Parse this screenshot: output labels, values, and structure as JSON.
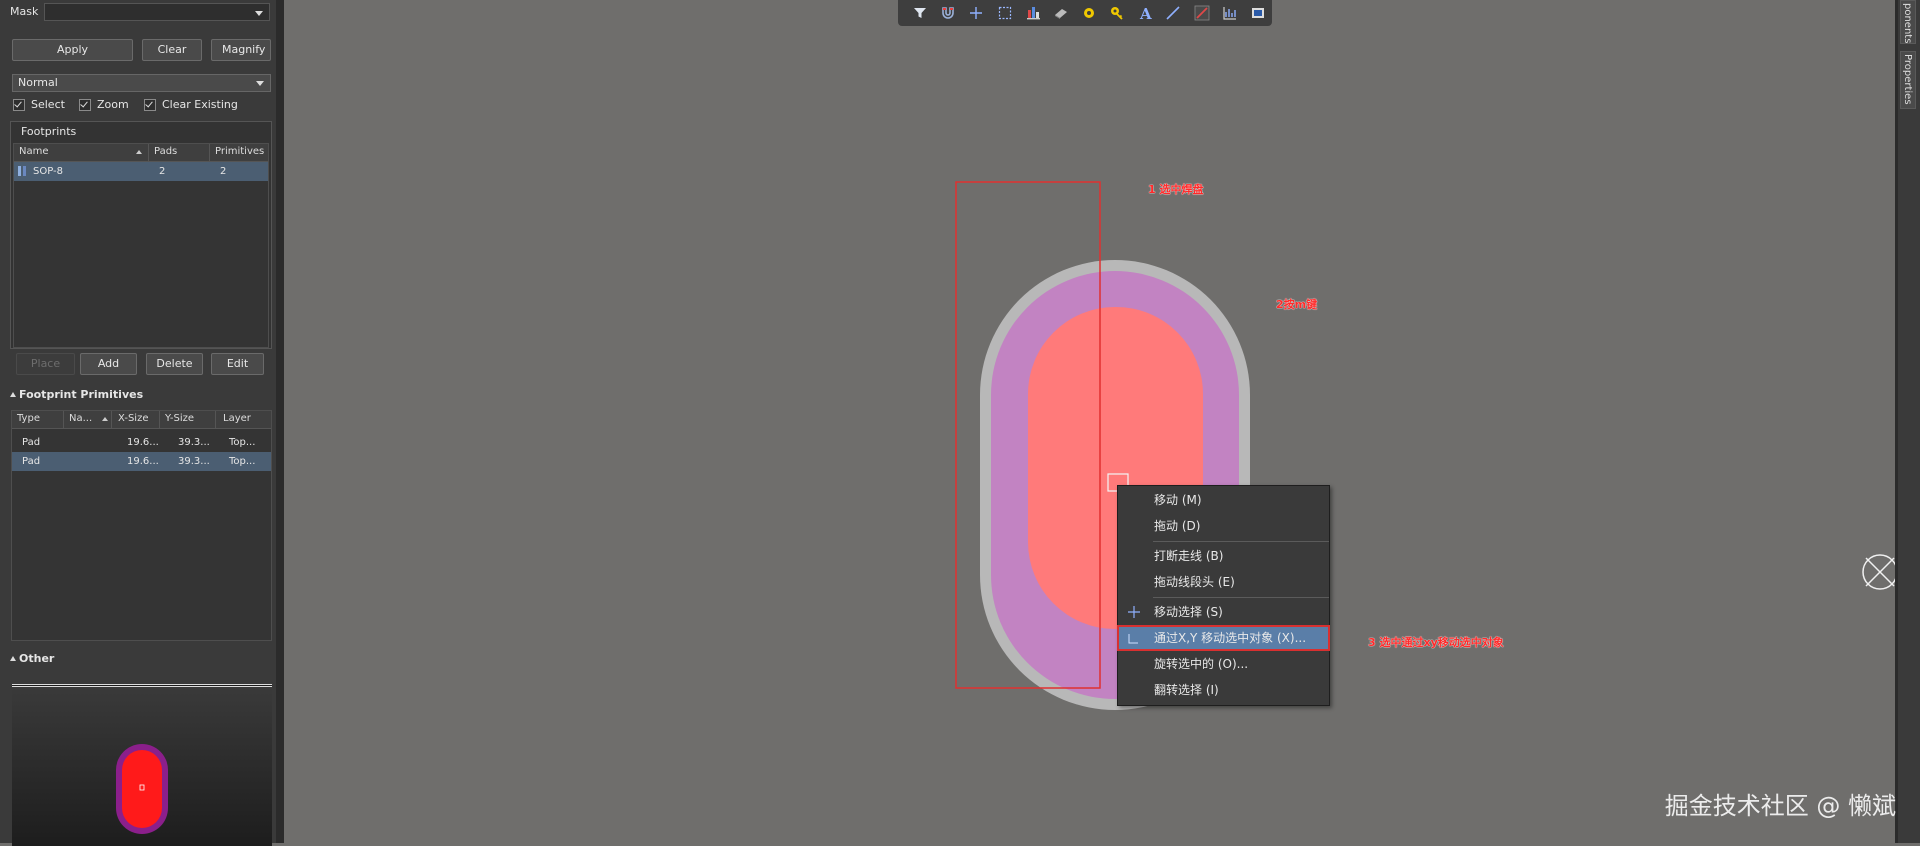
{
  "left_panel": {
    "mask_label": "Mask",
    "mask_value": "",
    "buttons": {
      "apply": "Apply",
      "clear": "Clear",
      "magnify": "Magnify"
    },
    "mode_select": "Normal",
    "checks": {
      "select": "Select",
      "zoom": "Zoom",
      "clear_existing": "Clear Existing"
    },
    "footprints": {
      "title": "Footprints",
      "columns": [
        "Name",
        "Pads",
        "Primitives"
      ],
      "rows": [
        {
          "name": "SOP-8",
          "pads": "2",
          "primitives": "2"
        }
      ],
      "actions": {
        "place": "Place",
        "add": "Add",
        "delete": "Delete",
        "edit": "Edit"
      }
    },
    "primitives": {
      "title": "Footprint Primitives",
      "columns": [
        "Type",
        "Na...",
        "X-Size",
        "Y-Size",
        "Layer"
      ],
      "rows": [
        {
          "type": "Pad",
          "name": "",
          "xsize": "19.6...",
          "ysize": "39.3...",
          "layer": "Top..."
        },
        {
          "type": "Pad",
          "name": "",
          "xsize": "19.6...",
          "ysize": "39.3...",
          "layer": "Top..."
        }
      ]
    },
    "other_title": "Other"
  },
  "toolbar": {
    "icons": [
      "filter-icon",
      "snap-magnet-icon",
      "crosshair-add-icon",
      "select-rect-icon",
      "align-icon",
      "component-icon",
      "pad-icon",
      "via-key-icon",
      "text-icon",
      "line-icon",
      "interactive-route-icon",
      "chart-icon",
      "board-shape-icon"
    ],
    "accent": "#f0c800"
  },
  "right_tabs": {
    "components": "ponents",
    "properties": "Properties"
  },
  "annotations": {
    "step1": "1 选中焊盘",
    "step2": "2按m键",
    "step3": "3 选中通过xy移动选中对象"
  },
  "context_menu": {
    "items": [
      {
        "label": "移动 (M)",
        "icon": ""
      },
      {
        "label": "拖动 (D)",
        "icon": ""
      },
      {
        "label": "打断走线 (B)",
        "icon": ""
      },
      {
        "label": "拖动线段头 (E)",
        "icon": ""
      },
      {
        "label": "移动选择 (S)",
        "icon": "move-cross-icon"
      },
      {
        "label": "通过X,Y 移动选中对象 (X)...",
        "icon": "move-xy-icon",
        "highlighted": true
      },
      {
        "label": "旋转选中的 (O)...",
        "icon": ""
      },
      {
        "label": "翻转选择 (I)",
        "icon": ""
      }
    ]
  },
  "colors": {
    "canvas": "#6f6e6c",
    "pad_copper": "#ff7a7a",
    "solder_mask": "#c283c2",
    "paste_outline": "#b8b8b8",
    "selection": "#e03030",
    "menu_highlight": "#5a7ea8"
  },
  "watermark": "掘金技术社区 @ 懒斌"
}
